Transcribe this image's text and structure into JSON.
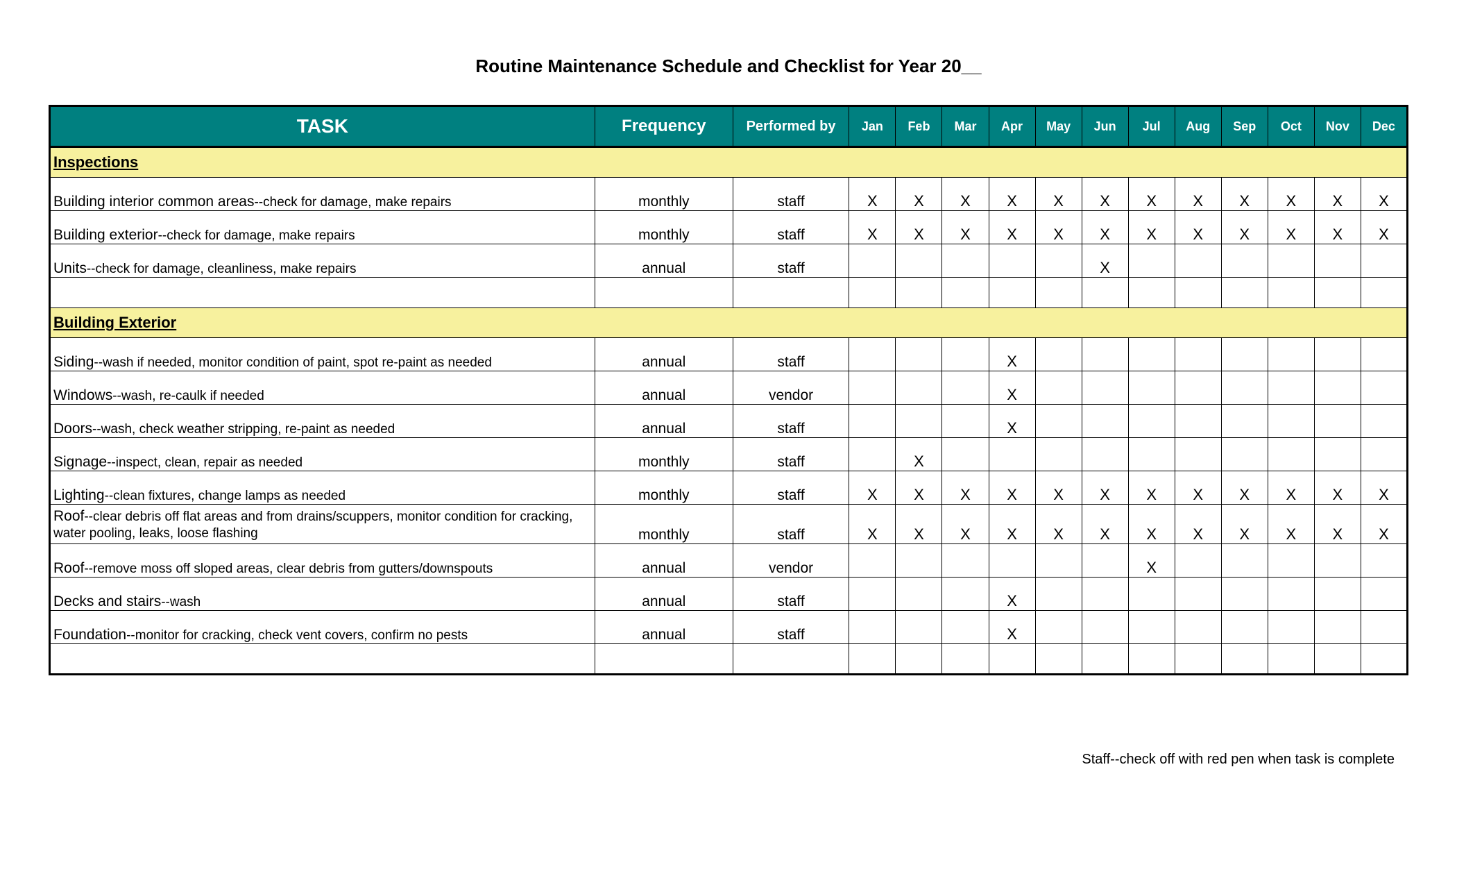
{
  "title": "Routine Maintenance Schedule and Checklist for Year 20__",
  "columns": {
    "task": "TASK",
    "frequency": "Frequency",
    "performed_by": "Performed by",
    "months": [
      "Jan",
      "Feb",
      "Mar",
      "Apr",
      "May",
      "Jun",
      "Jul",
      "Aug",
      "Sep",
      "Oct",
      "Nov",
      "Dec"
    ]
  },
  "mark": "X",
  "sections": [
    {
      "name": "Inspections",
      "rows": [
        {
          "task_main": "Building interior common areas",
          "task_sub": "--check for damage, make repairs",
          "frequency": "monthly",
          "performed_by": "staff",
          "months": [
            true,
            true,
            true,
            true,
            true,
            true,
            true,
            true,
            true,
            true,
            true,
            true
          ]
        },
        {
          "task_main": "Building exterior",
          "task_sub": "--check for damage, make repairs",
          "frequency": "monthly",
          "performed_by": "staff",
          "months": [
            true,
            true,
            true,
            true,
            true,
            true,
            true,
            true,
            true,
            true,
            true,
            true
          ]
        },
        {
          "task_main": "Units",
          "task_sub": "--check for damage, cleanliness, make repairs",
          "frequency": "annual",
          "performed_by": "staff",
          "months": [
            false,
            false,
            false,
            false,
            false,
            true,
            false,
            false,
            false,
            false,
            false,
            false
          ]
        }
      ],
      "spacer_after": true
    },
    {
      "name": "Building Exterior",
      "rows": [
        {
          "task_main": "Siding",
          "task_sub": "--wash if needed, monitor condition of paint, spot re-paint as needed",
          "frequency": "annual",
          "performed_by": "staff",
          "months": [
            false,
            false,
            false,
            true,
            false,
            false,
            false,
            false,
            false,
            false,
            false,
            false
          ]
        },
        {
          "task_main": "Windows",
          "task_sub": "--wash, re-caulk if needed",
          "frequency": "annual",
          "performed_by": "vendor",
          "months": [
            false,
            false,
            false,
            true,
            false,
            false,
            false,
            false,
            false,
            false,
            false,
            false
          ]
        },
        {
          "task_main": "Doors",
          "task_sub": "--wash, check weather stripping, re-paint as needed",
          "frequency": "annual",
          "performed_by": "staff",
          "months": [
            false,
            false,
            false,
            true,
            false,
            false,
            false,
            false,
            false,
            false,
            false,
            false
          ]
        },
        {
          "task_main": "Signage",
          "task_sub": "--inspect, clean, repair as needed",
          "frequency": "monthly",
          "performed_by": "staff",
          "months": [
            false,
            true,
            false,
            false,
            false,
            false,
            false,
            false,
            false,
            false,
            false,
            false
          ]
        },
        {
          "task_main": "Lighting",
          "task_sub": "--clean fixtures, change lamps as needed",
          "frequency": "monthly",
          "performed_by": "staff",
          "months": [
            true,
            true,
            true,
            true,
            true,
            true,
            true,
            true,
            true,
            true,
            true,
            true
          ]
        },
        {
          "wrap": true,
          "task_main": "Roof",
          "task_sub": "--clear debris off flat areas and from drains/scuppers, monitor condition for cracking, water pooling, leaks, loose flashing",
          "frequency": "monthly",
          "performed_by": "staff",
          "months": [
            true,
            true,
            true,
            true,
            true,
            true,
            true,
            true,
            true,
            true,
            true,
            true
          ]
        },
        {
          "task_main": "Roof",
          "task_sub": "--remove moss off sloped areas, clear debris from gutters/downspouts",
          "frequency": "annual",
          "performed_by": "vendor",
          "months": [
            false,
            false,
            false,
            false,
            false,
            false,
            true,
            false,
            false,
            false,
            false,
            false
          ]
        },
        {
          "task_main": "Decks and stairs",
          "task_sub": "--wash",
          "frequency": "annual",
          "performed_by": "staff",
          "months": [
            false,
            false,
            false,
            true,
            false,
            false,
            false,
            false,
            false,
            false,
            false,
            false
          ]
        },
        {
          "task_main": "Foundation",
          "task_sub": "--monitor for cracking, check vent covers, confirm no pests",
          "frequency": "annual",
          "performed_by": "staff",
          "months": [
            false,
            false,
            false,
            true,
            false,
            false,
            false,
            false,
            false,
            false,
            false,
            false
          ]
        }
      ],
      "spacer_after": true
    }
  ],
  "footnote": "Staff--check off with red pen when task is complete"
}
